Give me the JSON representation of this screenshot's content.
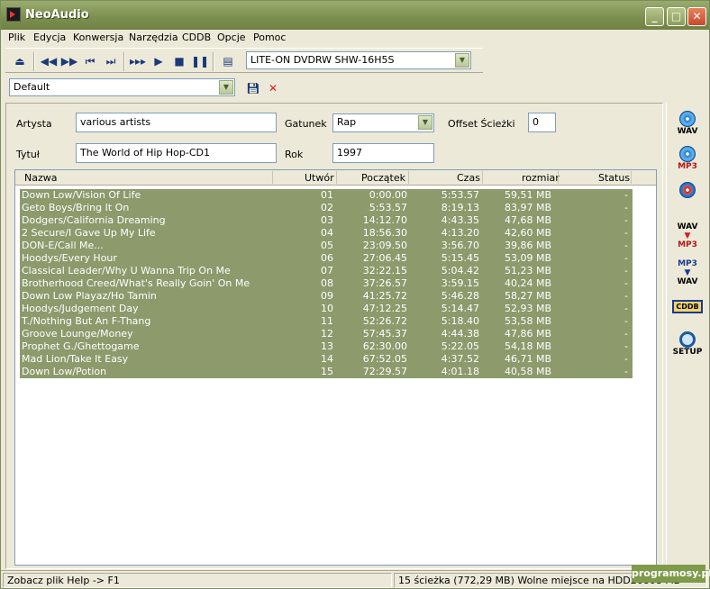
{
  "window": {
    "title": "NeoAudio",
    "min": "_",
    "max": "□",
    "close": "✕"
  },
  "menu": [
    "Plik",
    "Edycja",
    "Konwersja",
    "Narzędzia",
    "CDDB",
    "Opcje",
    "Pomoc"
  ],
  "drive": {
    "selected": "LITE-ON DVDRW SHW-16H5S"
  },
  "profile": {
    "selected": "Default"
  },
  "form": {
    "artist_label": "Artysta",
    "artist_value": "various artists",
    "genre_label": "Gatunek",
    "genre_value": "Rap",
    "offset_label": "Offset Ścieżki",
    "offset_value": "0",
    "title_label": "Tytuł",
    "title_value": "The World of Hip Hop-CD1",
    "year_label": "Rok",
    "year_value": "1997"
  },
  "columns": [
    "Nazwa",
    "Utwór",
    "Początek",
    "Czas",
    "rozmiar",
    "Status"
  ],
  "tracks": [
    {
      "name": "Down Low/Vision Of Life",
      "num": "01",
      "start": "0:00.00",
      "time": "5:53.57",
      "size": "59,51 MB",
      "status": "-"
    },
    {
      "name": "Geto Boys/Bring It On",
      "num": "02",
      "start": "5:53.57",
      "time": "8:19.13",
      "size": "83,97 MB",
      "status": "-"
    },
    {
      "name": "Dodgers/California Dreaming",
      "num": "03",
      "start": "14:12.70",
      "time": "4:43.35",
      "size": "47,68 MB",
      "status": "-"
    },
    {
      "name": "2 Secure/I Gave Up My Life",
      "num": "04",
      "start": "18:56.30",
      "time": "4:13.20",
      "size": "42,60 MB",
      "status": "-"
    },
    {
      "name": "DON-E/Call Me...",
      "num": "05",
      "start": "23:09.50",
      "time": "3:56.70",
      "size": "39,86 MB",
      "status": "-"
    },
    {
      "name": "Hoodys/Every Hour",
      "num": "06",
      "start": "27:06.45",
      "time": "5:15.45",
      "size": "53,09 MB",
      "status": "-"
    },
    {
      "name": "Classical Leader/Why U Wanna Trip On Me",
      "num": "07",
      "start": "32:22.15",
      "time": "5:04.42",
      "size": "51,23 MB",
      "status": "-"
    },
    {
      "name": "Brotherhood Creed/What's Really Goin' On Me",
      "num": "08",
      "start": "37:26.57",
      "time": "3:59.15",
      "size": "40,24 MB",
      "status": "-"
    },
    {
      "name": "Down Low Playaz/Ho Tamin",
      "num": "09",
      "start": "41:25.72",
      "time": "5:46.28",
      "size": "58,27 MB",
      "status": "-"
    },
    {
      "name": "Hoodys/Judgement Day",
      "num": "10",
      "start": "47:12.25",
      "time": "5:14.47",
      "size": "52,93 MB",
      "status": "-"
    },
    {
      "name": "T./Nothing But An F-Thang",
      "num": "11",
      "start": "52:26.72",
      "time": "5:18.40",
      "size": "53,58 MB",
      "status": "-"
    },
    {
      "name": "Groove Lounge/Money",
      "num": "12",
      "start": "57:45.37",
      "time": "4:44.38",
      "size": "47,86 MB",
      "status": "-"
    },
    {
      "name": "Prophet G./Ghettogame",
      "num": "13",
      "start": "62:30.00",
      "time": "5:22.05",
      "size": "54,18 MB",
      "status": "-"
    },
    {
      "name": "Mad Lion/Take It Easy",
      "num": "14",
      "start": "67:52.05",
      "time": "4:37.52",
      "size": "46,71 MB",
      "status": "-"
    },
    {
      "name": "Down Low/Potion",
      "num": "15",
      "start": "72:29.57",
      "time": "4:01.18",
      "size": "40,58 MB",
      "status": "-"
    }
  ],
  "sidebar": {
    "wav": "WAV",
    "mp3": "MP3",
    "wav_mp3_top": "WAV",
    "wav_mp3_bottom": "MP3",
    "mp3_wav_top": "MP3",
    "mp3_wav_bottom": "WAV",
    "cddb": "CDDB",
    "setup": "SETUP"
  },
  "status": {
    "help": "Zobacz plik Help -> F1",
    "info": "15 ścieżka (772,29 MB) Wolne miejsce na HDD26808 MB"
  },
  "watermark": "programosy.pl"
}
